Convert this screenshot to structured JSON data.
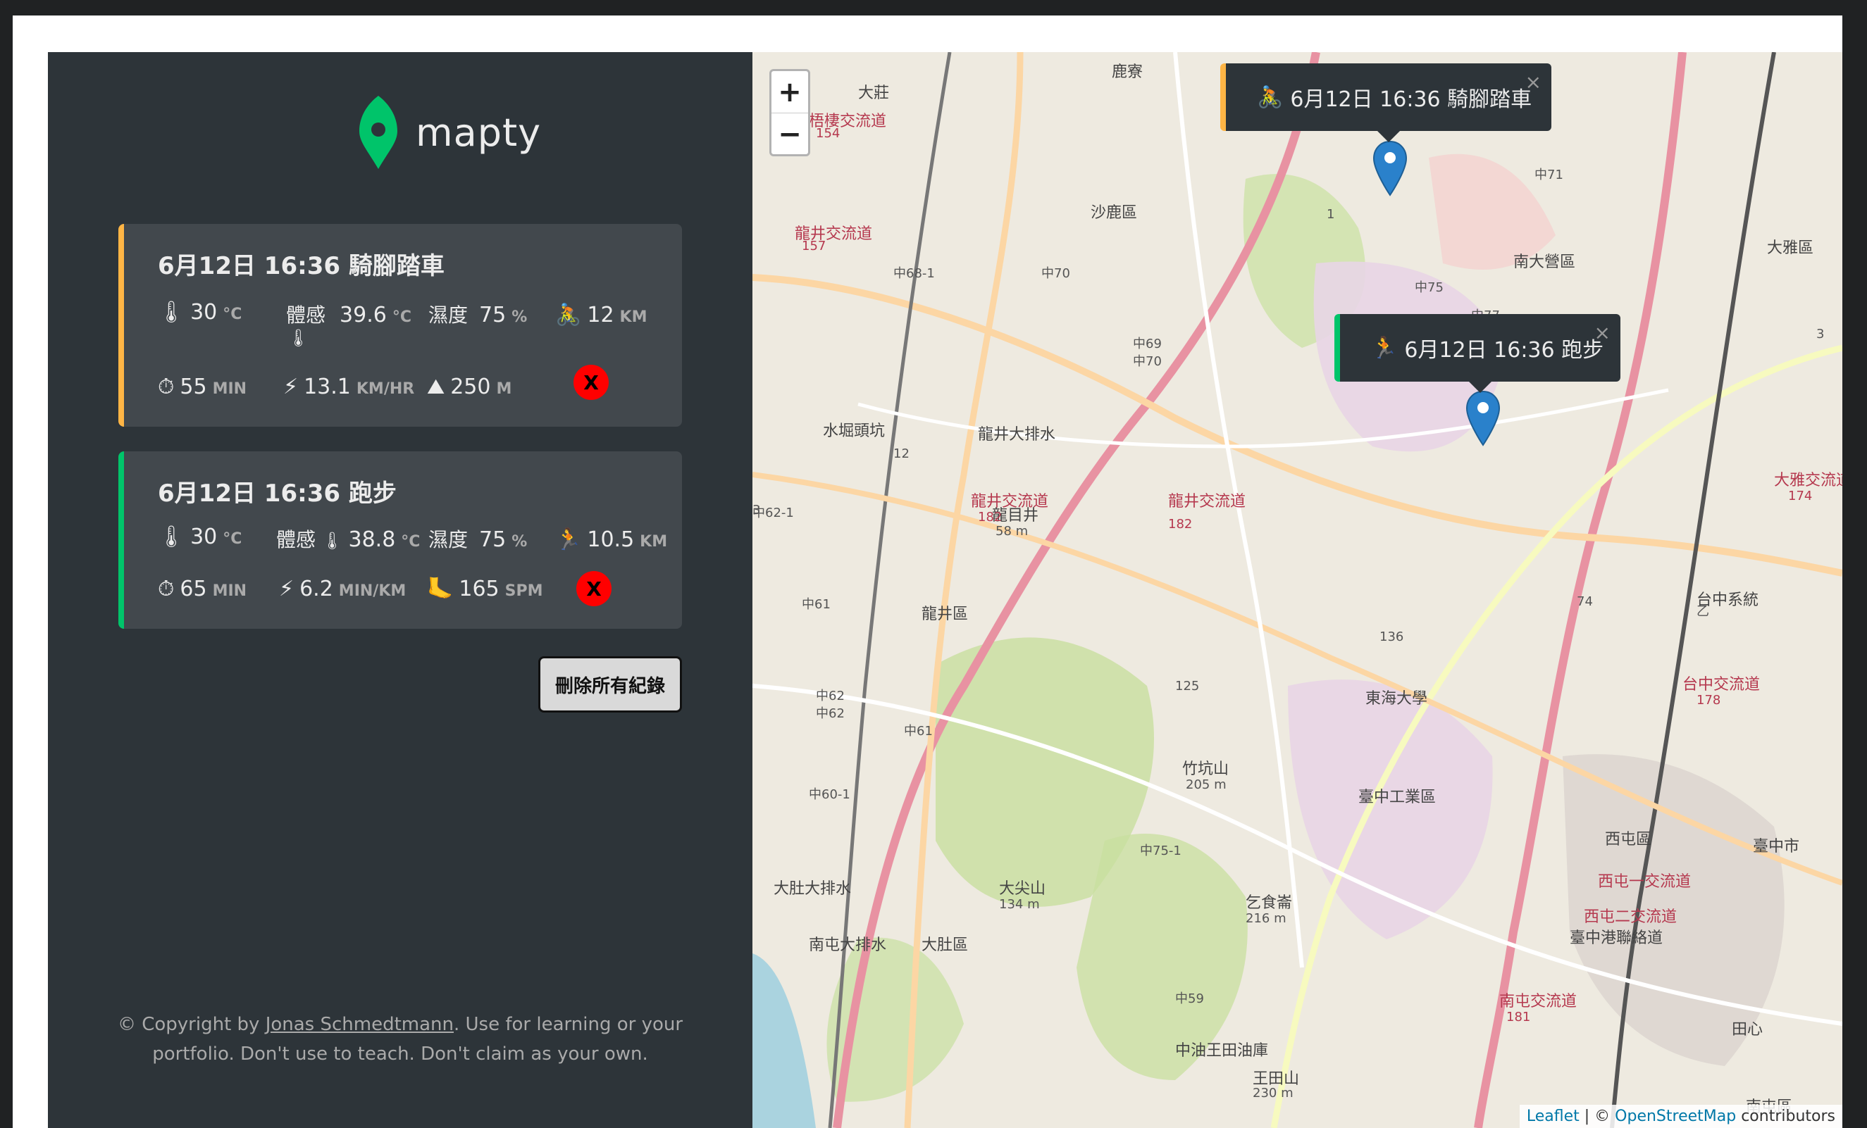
{
  "app": {
    "name": "mapty"
  },
  "workouts": [
    {
      "type": "cycling",
      "title": "6月12日 16:36 騎腳踏車",
      "temp": "30",
      "temp_unit": "°C",
      "feels_label": "體感",
      "feels": "39.6",
      "feels_unit": "°C",
      "humidity_label": "濕度",
      "humidity": "75",
      "humidity_unit": "%",
      "distance": "12",
      "distance_unit": "KM",
      "duration": "55",
      "duration_unit": "MIN",
      "speed": "13.1",
      "speed_unit": "KM/HR",
      "elevation": "250",
      "elevation_unit": "M",
      "delete_label": "X"
    },
    {
      "type": "running",
      "title": "6月12日 16:36 跑步",
      "temp": "30",
      "temp_unit": "°C",
      "feels_label": "體感",
      "feels": "38.8",
      "feels_unit": "°C",
      "humidity_label": "濕度",
      "humidity": "75",
      "humidity_unit": "%",
      "distance": "10.5",
      "distance_unit": "KM",
      "duration": "65",
      "duration_unit": "MIN",
      "pace": "6.2",
      "pace_unit": "MIN/KM",
      "cadence": "165",
      "cadence_unit": "SPM",
      "delete_label": "X"
    }
  ],
  "clear_all_label": "刪除所有紀錄",
  "copyright": {
    "prefix": "© Copyright by ",
    "author": "Jonas Schmedtmann",
    "suffix": ". Use for learning or your portfolio. Don't use to teach. Don't claim as your own."
  },
  "map": {
    "zoom_in": "+",
    "zoom_out": "−",
    "popups": [
      {
        "type": "cycling",
        "icon": "🚴",
        "label": "6月12日 16:36 騎腳踏車",
        "close": "×"
      },
      {
        "type": "running",
        "icon": "🏃",
        "label": "6月12日 16:36 跑步",
        "close": "×"
      }
    ],
    "places": [
      "鹿寮",
      "大莊",
      "沙鹿區",
      "大雅區",
      "南大營區",
      "龍井區",
      "龍目井",
      "58 m",
      "龍井交流道",
      "182",
      "東海大學",
      "竹坑山",
      "205 m",
      "臺中工業區",
      "西屯區",
      "臺中市",
      "大肚區",
      "大尖山",
      "134 m",
      "乞食崙",
      "216 m",
      "中油王田油庫",
      "王田山",
      "230 m",
      "田心",
      "南屯區",
      "台中交流道",
      "178",
      "大雅交流道",
      "174",
      "台中系統",
      "梧棲交流道",
      "154",
      "龍井交流道",
      "157",
      "龍井交流道",
      "182",
      "南屯交流道",
      "181",
      "西屯一交流道",
      "西屯二交流道",
      "臺中港聯絡道",
      "中70",
      "中68-1",
      "中69",
      "中70",
      "中75",
      "中71",
      "中77",
      "中62-1",
      "中61",
      "中62",
      "中62",
      "中61",
      "中60-1",
      "中75-1",
      "中59",
      "3",
      "1",
      "12",
      "136",
      "125",
      "74",
      "乙",
      "3",
      "大肚大排水",
      "南屯大排水",
      "龍井大排水",
      "水堀頭坑"
    ],
    "attribution_leaflet": "Leaflet",
    "attribution_sep": " | © ",
    "attribution_osm": "OpenStreetMap",
    "attribution_suffix": " contributors"
  },
  "colors": {
    "cycling": "#ffb545",
    "running": "#00c46a",
    "sidebar": "#2d3439",
    "card": "#42484d",
    "delete": "#ff0000"
  }
}
